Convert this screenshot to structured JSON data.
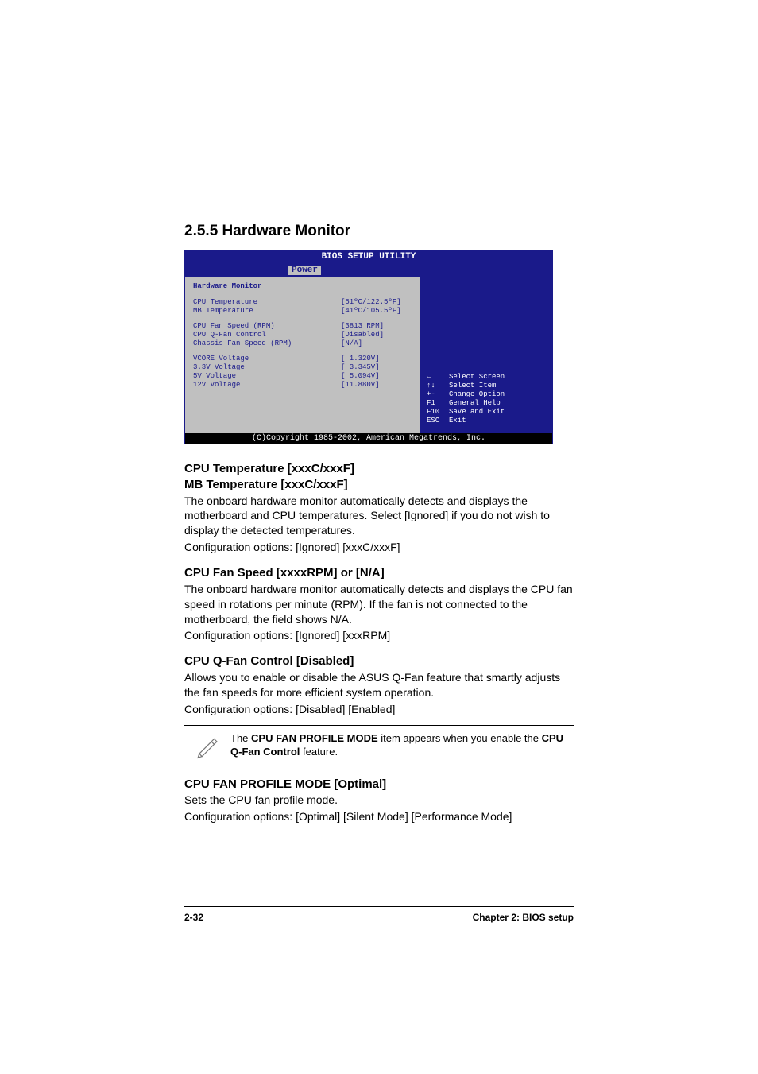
{
  "section_heading": "2.5.5   Hardware Monitor",
  "bios": {
    "title": "BIOS SETUP UTILITY",
    "active_tab": "Power",
    "panel_title": "Hardware Monitor",
    "items_group1": [
      {
        "label": "CPU Temperature",
        "value": "[51ºC/122.5ºF]"
      },
      {
        "label": "MB Temperature",
        "value": "[41ºC/105.5ºF]"
      }
    ],
    "items_group2": [
      {
        "label": "CPU Fan Speed (RPM)",
        "value": "[3813 RPM]"
      },
      {
        "label": "CPU Q-Fan Control",
        "value": "[Disabled]"
      },
      {
        "label": "Chassis Fan Speed (RPM)",
        "value": "[N/A]"
      }
    ],
    "items_group3": [
      {
        "label": "VCORE Voltage",
        "value": "[ 1.320V]"
      },
      {
        "label": "3.3V Voltage",
        "value": "[ 3.345V]"
      },
      {
        "label": "5V Voltage",
        "value": "[ 5.094V]"
      },
      {
        "label": "12V Voltage",
        "value": "[11.880V]"
      }
    ],
    "help": [
      {
        "key": "←",
        "label": "Select Screen"
      },
      {
        "key": "↑↓",
        "label": "Select Item"
      },
      {
        "key": "+-",
        "label": "Change Option"
      },
      {
        "key": "F1",
        "label": "General Help"
      },
      {
        "key": "F10",
        "label": "Save and Exit"
      },
      {
        "key": "ESC",
        "label": "Exit"
      }
    ],
    "copyright": "(C)Copyright 1985-2002, American Megatrends, Inc."
  },
  "sections": {
    "temp": {
      "h1": "CPU Temperature [xxxC/xxxF]",
      "h2": "MB Temperature [xxxC/xxxF]",
      "p1": "The onboard hardware monitor automatically detects and displays the motherboard and CPU temperatures. Select [Ignored] if you do not wish to display the detected temperatures.",
      "p2": "Configuration options: [Ignored] [xxxC/xxxF]"
    },
    "fan": {
      "h": "CPU Fan Speed [xxxxRPM] or [N/A]",
      "p1": "The onboard hardware monitor automatically detects and displays the CPU fan speed in rotations per minute (RPM). If the fan is not connected to the motherboard, the field shows N/A.",
      "p2": "Configuration options: [Ignored] [xxxRPM]"
    },
    "qfan": {
      "h": "CPU Q-Fan Control [Disabled]",
      "p1": "Allows you to enable or disable the ASUS Q-Fan feature that smartly adjusts the fan speeds for more efficient system operation.",
      "p2": "Configuration options: [Disabled] [Enabled]"
    },
    "note": {
      "prefix": "The ",
      "b1": "CPU FAN PROFILE MODE",
      "mid": " item appears when you enable the ",
      "b2": "CPU Q-Fan Control",
      "suffix": " feature."
    },
    "profile": {
      "h": "CPU FAN PROFILE MODE [Optimal]",
      "p1": "Sets the CPU fan profile mode.",
      "p2": "Configuration options: [Optimal] [Silent Mode] [Performance Mode]"
    }
  },
  "footer": {
    "left": "2-32",
    "right": "Chapter 2: BIOS setup"
  }
}
